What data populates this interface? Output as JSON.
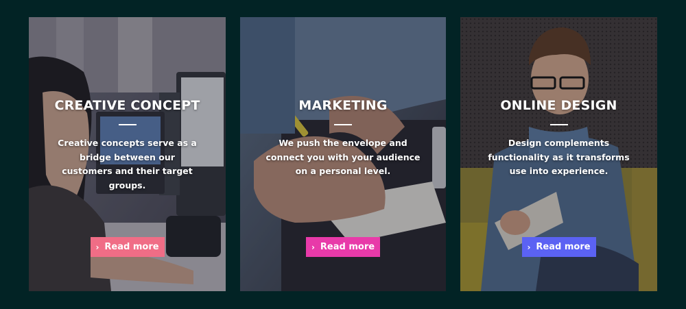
{
  "cards": [
    {
      "title": "CREATIVE CONCEPT",
      "description": "Creative concepts serve as a bridge between our customers and their target groups.",
      "button_label": "Read more",
      "button_icon": "chevron-right-icon",
      "button_color": "#f06d86"
    },
    {
      "title": "MARKETING",
      "description": "We push the envelope and connect you with your audience on a personal level.",
      "button_label": "Read more",
      "button_icon": "chevron-right-icon",
      "button_color": "#e83aa9"
    },
    {
      "title": "ONLINE DESIGN",
      "description": "Design complements functionality as it transforms use into experience.",
      "button_label": "Read more",
      "button_icon": "chevron-right-icon",
      "button_color": "#5b62f3"
    }
  ],
  "colors": {
    "page_background": "#022325"
  }
}
